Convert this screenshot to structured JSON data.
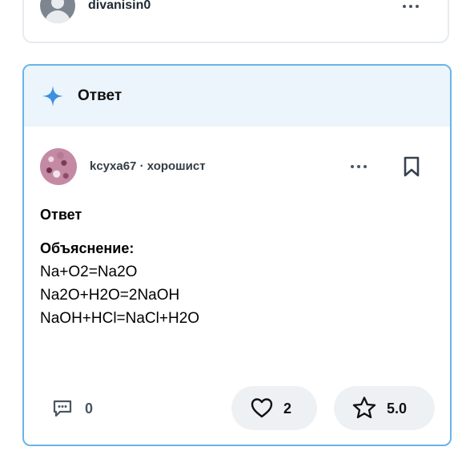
{
  "question": {
    "username": "divanisin0",
    "avatar_icon": "user-silhouette-icon",
    "more_icon": "more-dots-icon"
  },
  "answer": {
    "header_title": "Ответ",
    "header_icon": "sparkle-icon",
    "accent_color": "#68b4e8",
    "header_bg": "#ebf5fb",
    "author": "kcyxa67 · хорошист",
    "more_icon": "more-dots-icon",
    "bookmark_icon": "bookmark-icon",
    "body": {
      "heading": "Ответ",
      "explanation_label": "Объяснение:",
      "lines": [
        "Na+O2=Na2O",
        "Na2O+H2O=2NaOH",
        "NaOH+HCl=NaCl+H2O"
      ]
    },
    "footer": {
      "comment_icon": "comment-icon",
      "comments": "0",
      "like_icon": "heart-icon",
      "likes": "2",
      "rating_icon": "star-icon",
      "rating": "5.0"
    }
  }
}
